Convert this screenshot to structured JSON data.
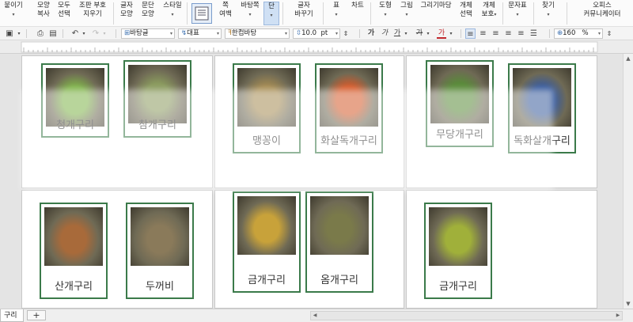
{
  "ribbon": {
    "buttons": [
      {
        "id": "paste",
        "l1": "붙이기",
        "l2": ""
      },
      {
        "id": "copy-format",
        "l1": "모양",
        "l2": "복사"
      },
      {
        "id": "select-all",
        "l1": "모두",
        "l2": "선택"
      },
      {
        "id": "clear-format",
        "l1": "조판 부호",
        "l2": "지우기"
      },
      {
        "id": "char-shape",
        "l1": "글자",
        "l2": "모양"
      },
      {
        "id": "para-shape",
        "l1": "문단",
        "l2": "모양"
      },
      {
        "id": "style",
        "l1": "스타일",
        "l2": ""
      },
      {
        "id": "page-layout",
        "l1": "",
        "l2": ""
      },
      {
        "id": "margins",
        "l1": "쪽",
        "l2": "여백"
      },
      {
        "id": "background",
        "l1": "바탕쪽",
        "l2": ""
      },
      {
        "id": "columns",
        "l1": "단",
        "l2": ""
      },
      {
        "id": "change-case",
        "l1": "글자",
        "l2": "바꾸기"
      },
      {
        "id": "table",
        "l1": "표",
        "l2": ""
      },
      {
        "id": "chart",
        "l1": "차트",
        "l2": ""
      },
      {
        "id": "shapes",
        "l1": "도형",
        "l2": ""
      },
      {
        "id": "picture",
        "l1": "그림",
        "l2": ""
      },
      {
        "id": "drawing",
        "l1": "그리기마당",
        "l2": ""
      },
      {
        "id": "select-object",
        "l1": "개체",
        "l2": "선택"
      },
      {
        "id": "protect-object",
        "l1": "개체",
        "l2": "보호"
      },
      {
        "id": "char-table",
        "l1": "문자표",
        "l2": ""
      },
      {
        "id": "find",
        "l1": "찾기",
        "l2": ""
      },
      {
        "id": "office-community",
        "l1": "오피스",
        "l2": "커뮤니케이터"
      }
    ]
  },
  "format_toolbar": {
    "style_value": "바탕글",
    "language_value": "대표",
    "font_value": "한컴바탕",
    "font_size_value": "10.0",
    "font_size_unit": "pt",
    "char_buttons": [
      "가",
      "가",
      "가",
      "가",
      "가"
    ],
    "zoom_value": "160",
    "zoom_unit": "%"
  },
  "cards": [
    {
      "name": "청개구리",
      "color": "#7fb24a"
    },
    {
      "name": "참개구리",
      "color": "#8a9a5e"
    },
    {
      "name": "맹꽁이",
      "color": "#a58b52"
    },
    {
      "name": "화살독개구리",
      "color": "#d45a2a"
    },
    {
      "name": "무당개구리",
      "color": "#5a8a3a"
    },
    {
      "name": "독화살개구리",
      "color": "#3a5c9c"
    },
    {
      "name": "산개구리",
      "color": "#a86a3a"
    },
    {
      "name": "두꺼비",
      "color": "#8a7a5a"
    },
    {
      "name": "금개구리",
      "color": "#c8a23a"
    },
    {
      "name": "옴개구리",
      "color": "#7a7a4a"
    },
    {
      "name": "금개구리",
      "color": "#a0b03a"
    }
  ],
  "tabs": {
    "active_label": "구리",
    "add_label": "+"
  }
}
